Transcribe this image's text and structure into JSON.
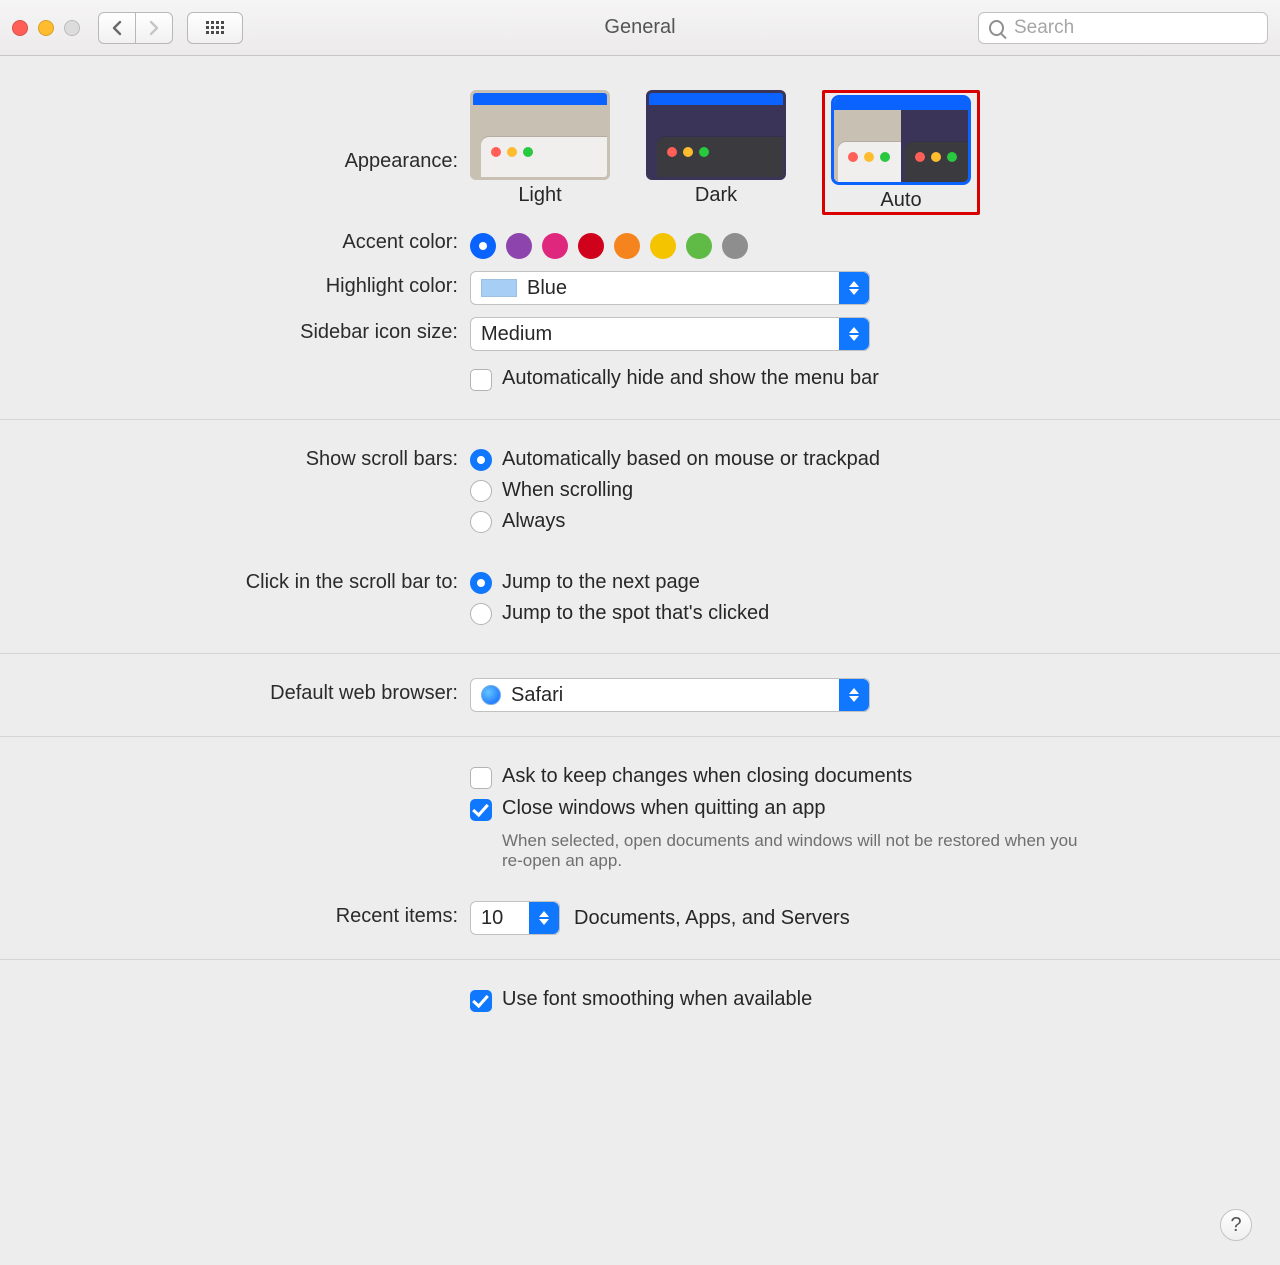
{
  "window": {
    "title": "General"
  },
  "toolbar": {
    "search_placeholder": "Search"
  },
  "appearance": {
    "label": "Appearance:",
    "options": {
      "light": "Light",
      "dark": "Dark",
      "auto": "Auto"
    },
    "selected": "auto"
  },
  "accent": {
    "label": "Accent color:",
    "colors": [
      "#0a63ff",
      "#8e44ad",
      "#e0277e",
      "#d0021b",
      "#f5841f",
      "#f5c400",
      "#5fba46",
      "#8e8e8e"
    ],
    "selected_index": 0
  },
  "highlight": {
    "label": "Highlight color:",
    "value": "Blue"
  },
  "sidebar_icon": {
    "label": "Sidebar icon size:",
    "value": "Medium"
  },
  "menubar_autohide": {
    "label": "Automatically hide and show the menu bar",
    "checked": false
  },
  "scrollbars": {
    "show_label": "Show scroll bars:",
    "opts": {
      "auto": "Automatically based on mouse or trackpad",
      "scroll": "When scrolling",
      "always": "Always"
    },
    "selected": "auto",
    "click_label": "Click in the scroll bar to:",
    "click_opts": {
      "page": "Jump to the next page",
      "spot": "Jump to the spot that's clicked"
    },
    "click_selected": "page"
  },
  "default_browser": {
    "label": "Default web browser:",
    "value": "Safari"
  },
  "documents": {
    "ask_label": "Ask to keep changes when closing documents",
    "ask_checked": false,
    "close_label": "Close windows when quitting an app",
    "close_checked": true,
    "close_help": "When selected, open documents and windows will not be restored when you re-open an app."
  },
  "recent_items": {
    "label": "Recent items:",
    "value": "10",
    "suffix": "Documents, Apps, and Servers"
  },
  "font_smoothing": {
    "label": "Use font smoothing when available",
    "checked": true
  },
  "help_button": "?"
}
